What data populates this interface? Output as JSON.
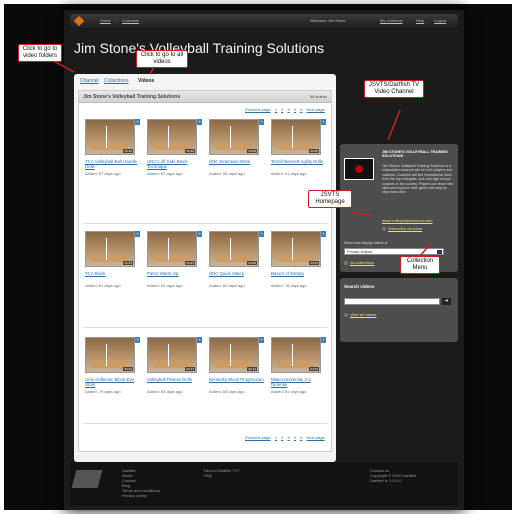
{
  "topbar": {
    "links": [
      "Home",
      "Channels",
      "Welcome Jim Stone",
      "My channels",
      "Help",
      "Logout"
    ]
  },
  "channel": {
    "title": "Jim Stone's Volleyball Training Solutions"
  },
  "tabs": [
    "Channel",
    "Collections",
    "Videos"
  ],
  "box": {
    "title": "Jim Stone's Volleyball Training Solutions",
    "count": "56 videos"
  },
  "pager": {
    "prev": "Previous page",
    "pages": [
      "1",
      "2",
      "3",
      "4",
      "5"
    ],
    "next": "Next page"
  },
  "videos": [
    {
      "title": "TCA Volleyball Ball Handle Drills",
      "added": "Added: 57 days ago",
      "dur": "04:10"
    },
    {
      "title": "UNC's off Side Block Technique",
      "added": "Added: 57 days ago",
      "dur": "03:30"
    },
    {
      "title": "SNC Extension Work",
      "added": "Added: 59 days ago",
      "dur": "05:08"
    },
    {
      "title": "Terrell Bennett Agility Drills",
      "added": "Added: 61 days ago",
      "dur": "02:06"
    },
    {
      "title": "TCA Block",
      "added": "Added: 61 days ago",
      "dur": "02:53"
    },
    {
      "title": "Patrol Warm-Up",
      "added": "Added: 62 days ago",
      "dur": "04:45"
    },
    {
      "title": "SNC Quick Attack",
      "added": "Added: 62 days ago",
      "dur": "03:20"
    },
    {
      "title": "Basics of Setting",
      "added": "Added: 78 days ago",
      "dur": "04:01"
    },
    {
      "title": "Univ of Illinois: Block Eye Work",
      "added": "Added: 79 days ago",
      "dur": "02:24"
    },
    {
      "title": "Volleyball Fitness Drills",
      "added": "Added: 83 days ago",
      "dur": "03:17"
    },
    {
      "title": "Kentucky Block Progression",
      "added": "Added: 83 days ago",
      "dur": "02:13"
    },
    {
      "title": "Miami University 2-2 Defense",
      "added": "Added: 84 days ago",
      "dur": "04:02"
    }
  ],
  "sidebar": {
    "channel_name": "JIM STONE'S VOLLEYBALL TRAINING SOLUTIONS",
    "description": "Jim Stone's Volleyball Training Solutions is a subscription channel site for both players and coaches. Coaches will find instructional video from the top collegiate, club and high school coaches in the country. Players can learn new skills and improve their game with step by step instruction.",
    "website": "www.volleyballsolutions.com",
    "subscribe": "Subscribe via Atom",
    "select_label": "Select one display videos of",
    "select_value": "Private videos",
    "all_collections": "All collections",
    "search_title": "Search videos",
    "view_all": "View all videos"
  },
  "footer": {
    "col1": [
      "Dartfish",
      "About",
      "Contact",
      "Blog",
      "Terms and conditions",
      "Privacy policy"
    ],
    "col2": [
      "New to Dartfish TV?",
      "FAQ"
    ],
    "col3": [
      "Contact us",
      "Copyright © 2010 Dartfish",
      "Dartfish tv 1.0.4.0"
    ]
  },
  "annotations": {
    "folders": "Click to go to video folders",
    "all_videos": "Click to go to all videos",
    "channel": "JSVTS/Dartfish TV Video Channel",
    "homepage": "JSVTS Homepage",
    "collection_menu": "Collection Menu"
  },
  "colors": {
    "annotation_border": "#cc2020",
    "link": "#2a6fa8",
    "accent": "#d8741e"
  }
}
